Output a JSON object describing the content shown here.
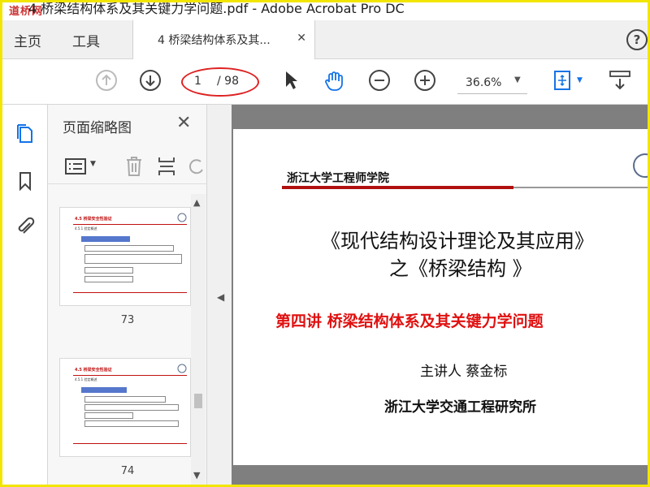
{
  "window": {
    "title": "4 桥梁结构体系及其关键力学问题.pdf - Adobe Acrobat Pro DC",
    "watermark": "道桥网"
  },
  "tabs": {
    "home": "主页",
    "tools": "工具",
    "document": "4 桥梁结构体系及其..."
  },
  "toolbar": {
    "current_page": "1",
    "total_pages": "/ 98",
    "zoom": "36.6%"
  },
  "thumbnail_panel": {
    "title": "页面缩略图",
    "thumbnails": [
      {
        "page_number": "73",
        "heading": "4.5 桥梁安全性验证",
        "section": "4.5.1 验定概述"
      },
      {
        "page_number": "74",
        "heading": "4.5 桥梁安全性验证",
        "section": "4.5.1 验定概述"
      }
    ]
  },
  "document": {
    "header": "浙江大学工程师学院",
    "title_line1": "《现代结构设计理论及其应用》",
    "title_line2": "之《桥梁结构 》",
    "subtitle": "第四讲  桥梁结构体系及其关键力学问题",
    "speaker": "主讲人  蔡金标",
    "organization": "浙江大学交通工程研究所"
  },
  "colors": {
    "accent_blue": "#1473e6",
    "annotation_red": "#dd2222",
    "doc_red": "#e01010"
  }
}
